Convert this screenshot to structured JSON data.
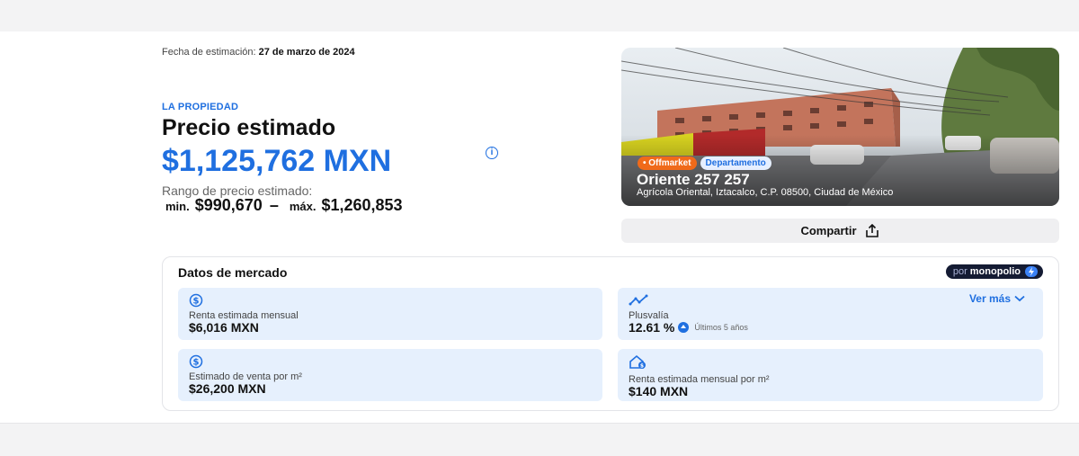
{
  "estimate_date": {
    "label": "Fecha de estimación:",
    "value": "27 de marzo de 2024"
  },
  "property": {
    "kicker": "LA PROPIEDAD",
    "title": "Precio estimado",
    "price": "$1,125,762 MXN",
    "range_label": "Rango de precio estimado:",
    "min_label": "min.",
    "min_value": "$990,670",
    "separator": "–",
    "max_label": "máx.",
    "max_value": "$1,260,853"
  },
  "listing": {
    "badges": [
      "Offmarket",
      "Departamento"
    ],
    "title": "Oriente 257 257",
    "address": "Agrícola Oriental, Iztacalco, C.P. 08500, Ciudad de México"
  },
  "share": {
    "label": "Compartir"
  },
  "market": {
    "title": "Datos de mercado",
    "provider_prefix": "por",
    "provider": "monopolio",
    "see_more": "Ver más",
    "cards": [
      {
        "label": "Renta estimada mensual",
        "value": "$6,016 MXN"
      },
      {
        "label": "Plusvalía",
        "value": "12.61 %",
        "period": "Últimos 5 años"
      },
      {
        "label": "Estimado de venta por m²",
        "value": "$26,200 MXN"
      },
      {
        "label": "Renta estimada mensual por m²",
        "value": "$140 MXN"
      }
    ]
  },
  "colors": {
    "accent": "#1f6fe0",
    "offmarket": "#f06a1a",
    "card_bg": "#e6f0fd",
    "brand_dark": "#141b33"
  },
  "icons": [
    "info-icon",
    "share-icon",
    "dollar-icon",
    "trend-chart-icon",
    "home-price-icon",
    "bolt-icon",
    "chevron-down-icon",
    "trend-up-icon"
  ]
}
